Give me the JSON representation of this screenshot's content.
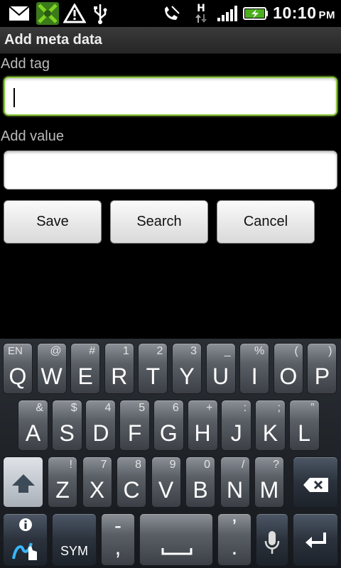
{
  "status_bar": {
    "network_type": "H",
    "time": "10:10",
    "ampm": "PM",
    "icons": [
      "mail-icon",
      "app-notification-icon",
      "warning-icon",
      "usb-icon",
      "mute-icon",
      "data-arrows-icon",
      "signal-icon",
      "battery-charging-icon"
    ]
  },
  "title": "Add meta data",
  "form": {
    "tag_label": "Add tag",
    "tag_value": "",
    "value_label": "Add value",
    "value_value": ""
  },
  "buttons": {
    "save": "Save",
    "search": "Search",
    "cancel": "Cancel"
  },
  "keyboard": {
    "row1": [
      {
        "k": "Q",
        "a": "EN"
      },
      {
        "k": "W",
        "a": "@"
      },
      {
        "k": "E",
        "a": "#"
      },
      {
        "k": "R",
        "a": "1"
      },
      {
        "k": "T",
        "a": "2"
      },
      {
        "k": "Y",
        "a": "3"
      },
      {
        "k": "U",
        "a": "_"
      },
      {
        "k": "I",
        "a": "%"
      },
      {
        "k": "O",
        "a": "("
      },
      {
        "k": "P",
        "a": ")"
      }
    ],
    "row2": [
      {
        "k": "A",
        "a": "&"
      },
      {
        "k": "S",
        "a": "$"
      },
      {
        "k": "D",
        "a": "4"
      },
      {
        "k": "F",
        "a": "5"
      },
      {
        "k": "G",
        "a": "6"
      },
      {
        "k": "H",
        "a": "+"
      },
      {
        "k": "J",
        "a": ":"
      },
      {
        "k": "K",
        "a": ";"
      },
      {
        "k": "L",
        "a": "”"
      }
    ],
    "row3": [
      {
        "k": "Z",
        "a": "!"
      },
      {
        "k": "X",
        "a": "7"
      },
      {
        "k": "C",
        "a": "8"
      },
      {
        "k": "V",
        "a": "9"
      },
      {
        "k": "B",
        "a": "0"
      },
      {
        "k": "N",
        "a": "/"
      },
      {
        "k": "M",
        "a": "?"
      }
    ],
    "sym_label": "SYM",
    "comma_key": {
      "k": ",",
      "a": "-"
    },
    "period_key": {
      "k": ".",
      "a": "’"
    },
    "accent_color": "#8cc63e"
  }
}
